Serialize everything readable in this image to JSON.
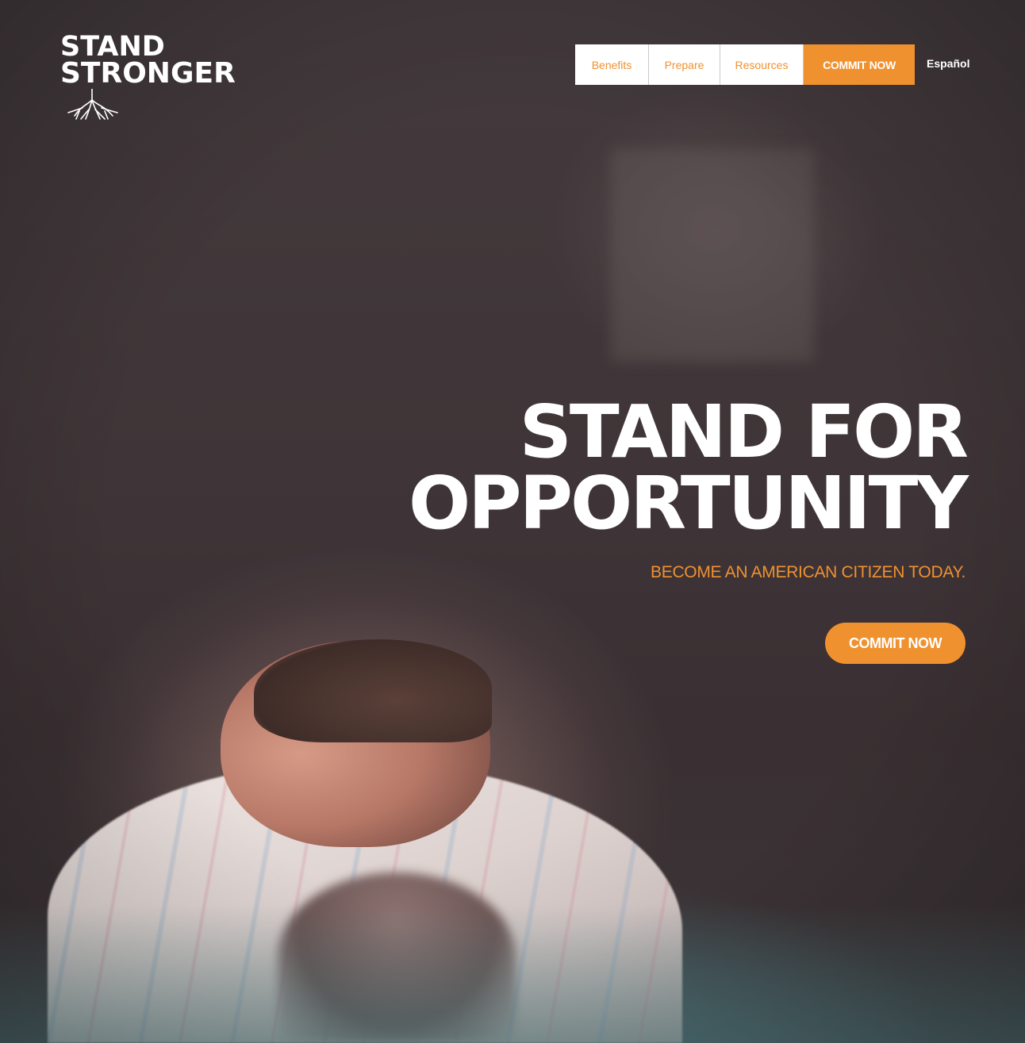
{
  "logo": {
    "line1": "STAND",
    "line2": "STRONGER"
  },
  "nav": {
    "items": [
      {
        "label": "Benefits"
      },
      {
        "label": "Prepare"
      },
      {
        "label": "Resources"
      }
    ],
    "cta_label": "COMMIT NOW",
    "language_link": "Español"
  },
  "hero": {
    "headline_line1": "STAND FOR",
    "headline_line2": "OPPORTUNITY",
    "subheadline": "BECOME AN AMERICAN CITIZEN TODAY.",
    "button_label": "COMMIT NOW"
  },
  "colors": {
    "accent": "#f0912f",
    "background": "#3e3537",
    "text": "#ffffff"
  }
}
